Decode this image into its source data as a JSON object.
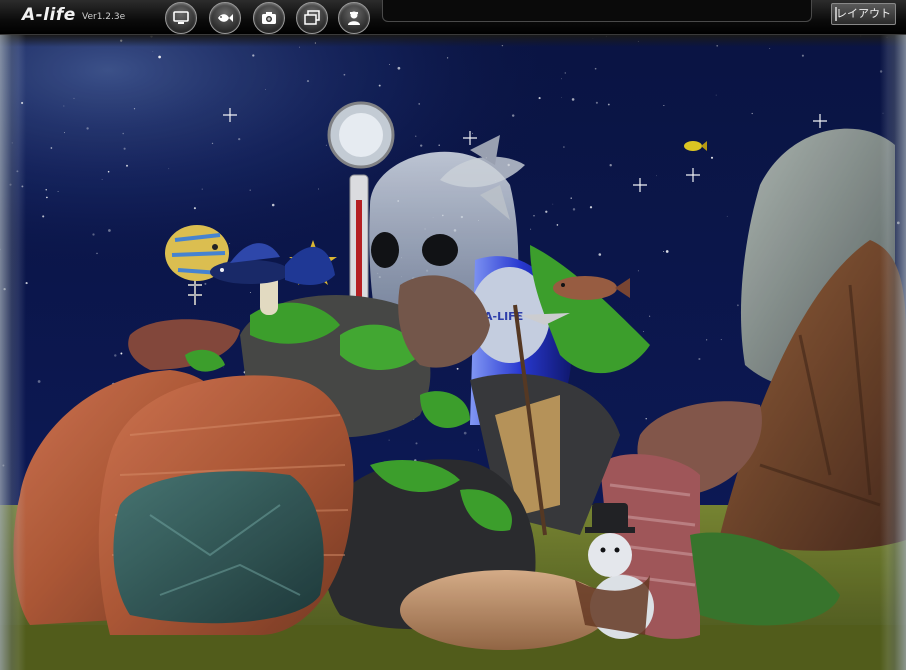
{
  "app": {
    "logo": "A-life",
    "version": "Ver1.2.3e"
  },
  "toolbar": {
    "buttons": [
      {
        "name": "display-button",
        "icon": "monitor-icon"
      },
      {
        "name": "fish-button",
        "icon": "fish-icon"
      },
      {
        "name": "camera-button",
        "icon": "camera-icon"
      },
      {
        "name": "window-button",
        "icon": "windows-icon"
      },
      {
        "name": "person-button",
        "icon": "person-icon"
      }
    ],
    "status_text": "",
    "layout_label": "レイアウト"
  },
  "scene": {
    "thermometer_icon": "thermometer",
    "sign_text": "A-LIFE",
    "colors": {
      "space": "#0c1648",
      "nebula": "#3a5aa8",
      "gravel": "#6f7a2a",
      "orange_rock": "#c0603a",
      "teal_rock": "#2f5f5a",
      "dark_rock": "#2a2a2a",
      "brown_rock": "#7a4a2a",
      "moss": "#3fa62a"
    }
  }
}
